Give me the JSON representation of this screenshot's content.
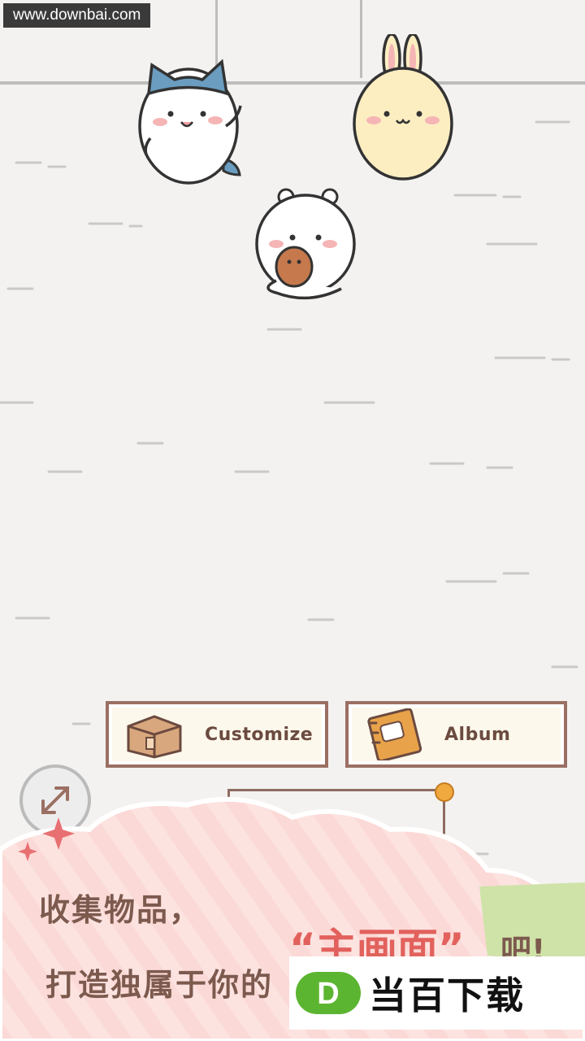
{
  "watermark": {
    "text": "www.downbai.com"
  },
  "characters": {
    "cat_name": "hachiware",
    "bunny_name": "usagi",
    "bear_name": "chiikawa"
  },
  "buttons": {
    "customize_label": "Customize",
    "album_label": "Album",
    "customize_icon": "box-icon",
    "album_icon": "notebook-icon",
    "expand_icon": "expand-icon"
  },
  "promo": {
    "line1": "收集物品，",
    "line2": "打造独属于你的",
    "highlight": "“主画面”",
    "line_end": "吧!"
  },
  "brand": {
    "text": "当百下载",
    "logo_letter": "D"
  },
  "colors": {
    "button_border": "#9b6f63",
    "button_fill": "#fdf8ec",
    "notification": "#f0a93f",
    "highlight": "#e2615d",
    "brand_green": "#5cb531"
  }
}
